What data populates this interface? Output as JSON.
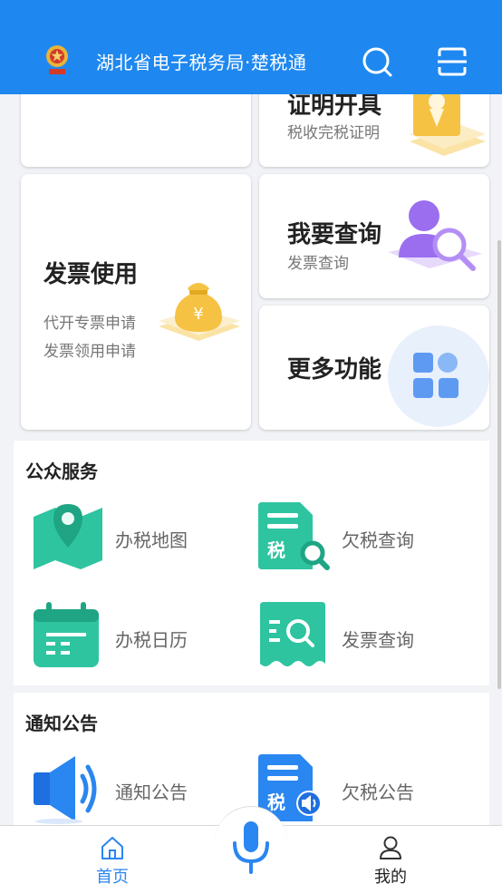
{
  "header": {
    "title": "湖北省电子税务局·楚税通"
  },
  "cards": {
    "certificate": {
      "title": "证明开具",
      "sub": "税收完税证明"
    },
    "invoice_use": {
      "title": "发票使用",
      "items": [
        "代开专票申请",
        "发票领用申请"
      ]
    },
    "query": {
      "title": "我要查询",
      "sub": "发票查询"
    },
    "more": {
      "title": "更多功能"
    }
  },
  "public_services": {
    "title": "公众服务",
    "items": [
      {
        "label": "办税地图",
        "icon": "map-pin-icon"
      },
      {
        "label": "欠税查询",
        "icon": "tax-search-icon"
      },
      {
        "label": "办税日历",
        "icon": "calendar-icon"
      },
      {
        "label": "发票查询",
        "icon": "invoice-search-icon"
      }
    ]
  },
  "notices": {
    "title": "通知公告",
    "items": [
      {
        "label": "通知公告",
        "icon": "speaker-icon"
      },
      {
        "label": "欠税公告",
        "icon": "tax-notice-icon"
      }
    ]
  },
  "bottom_nav": {
    "home": "首页",
    "mine": "我的"
  },
  "colors": {
    "primary": "#1e88f0",
    "teal": "#2ec4a0",
    "gold": "#f6c244",
    "purple": "#9b6ef0"
  }
}
